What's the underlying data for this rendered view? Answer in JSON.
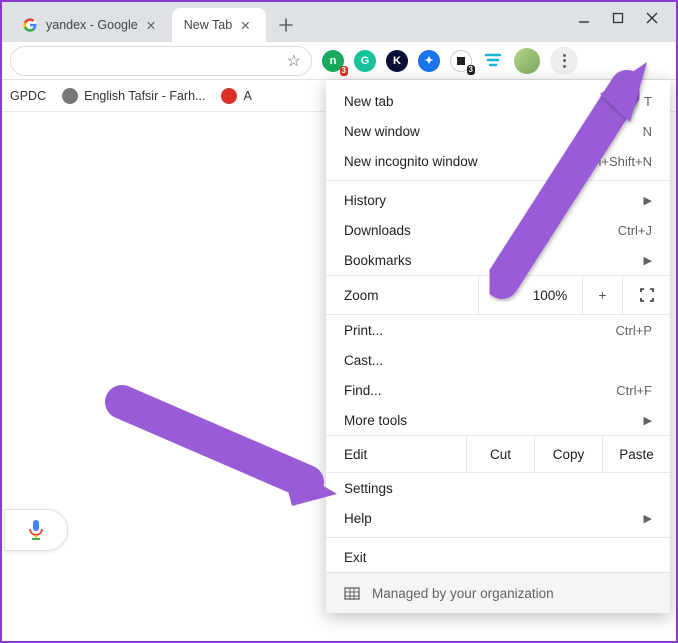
{
  "tabs": [
    {
      "title": "yandex - Google",
      "active": false
    },
    {
      "title": "New Tab",
      "active": true
    }
  ],
  "omnibox": {
    "value": ""
  },
  "bookmarks": [
    {
      "label": "GPDC"
    },
    {
      "label": "English Tafsir - Farh..."
    },
    {
      "label": "A"
    }
  ],
  "ext_badges": {
    "first": "3",
    "fifth": "3"
  },
  "menu": {
    "newtab": {
      "label": "New tab",
      "shortcut": "T"
    },
    "newwin": {
      "label": "New window",
      "shortcut": "N"
    },
    "incog": {
      "label": "New incognito window",
      "shortcut": "Ctrl+Shift+N"
    },
    "history": {
      "label": "History"
    },
    "downloads": {
      "label": "Downloads",
      "shortcut": "Ctrl+J"
    },
    "bookmarks": {
      "label": "Bookmarks"
    },
    "zoom": {
      "label": "Zoom",
      "value": "100%"
    },
    "print": {
      "label": "Print...",
      "shortcut": "Ctrl+P"
    },
    "cast": {
      "label": "Cast..."
    },
    "find": {
      "label": "Find...",
      "shortcut": "Ctrl+F"
    },
    "moretools": {
      "label": "More tools"
    },
    "edit": {
      "label": "Edit",
      "cut": "Cut",
      "copy": "Copy",
      "paste": "Paste"
    },
    "settings": {
      "label": "Settings"
    },
    "help": {
      "label": "Help"
    },
    "exit": {
      "label": "Exit"
    },
    "managed": {
      "label": "Managed by your organization"
    }
  }
}
